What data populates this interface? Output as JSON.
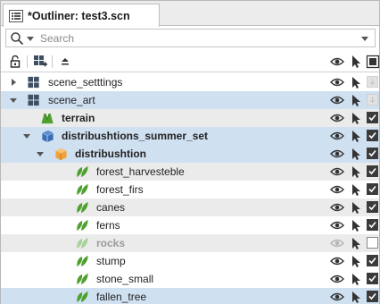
{
  "tab": {
    "title": "*Outliner: test3.scn",
    "icon": "outliner-list-icon"
  },
  "search": {
    "placeholder": "Search",
    "value": ""
  },
  "toolbar": {
    "icons": [
      "lock-icon",
      "add-group-icon",
      "collapse-up-icon",
      "eye-icon",
      "select-arrow-icon",
      "checkbox-column-icon"
    ]
  },
  "colors": {
    "selected_row": "#cfe0f1",
    "alt_row": "#ebebeb",
    "leaf_green": "#4ea12e",
    "leaf_green_dim": "#a8d39a",
    "box_blue": "#3a6db5",
    "box_orange": "#f0a23c"
  },
  "rows": [
    {
      "label": "scene_setttings",
      "icon": "scene-blocks-icon",
      "expander": "collapsed",
      "bold": false,
      "visible": true,
      "checkbox": "disabled"
    },
    {
      "label": "scene_art",
      "icon": "scene-blocks-icon",
      "expander": "expanded",
      "bold": false,
      "visible": true,
      "checkbox": "disabled"
    },
    {
      "label": "terrain",
      "icon": "terrain-icon",
      "expander": "none",
      "bold": true,
      "visible": true,
      "checkbox": "checked"
    },
    {
      "label": "distribushtions_summer_set",
      "icon": "blue-box-icon",
      "expander": "expanded",
      "bold": true,
      "visible": true,
      "checkbox": "checked"
    },
    {
      "label": "distribushtion",
      "icon": "orange-box-icon",
      "expander": "expanded",
      "bold": true,
      "visible": true,
      "checkbox": "checked"
    },
    {
      "label": "forest_harvesteble",
      "icon": "leaf-icon",
      "expander": "none",
      "bold": false,
      "visible": true,
      "checkbox": "checked"
    },
    {
      "label": "forest_firs",
      "icon": "leaf-icon",
      "expander": "none",
      "bold": false,
      "visible": true,
      "checkbox": "checked"
    },
    {
      "label": "canes",
      "icon": "leaf-icon",
      "expander": "none",
      "bold": false,
      "visible": true,
      "checkbox": "checked"
    },
    {
      "label": "ferns",
      "icon": "leaf-icon",
      "expander": "none",
      "bold": false,
      "visible": true,
      "checkbox": "checked"
    },
    {
      "label": "rocks",
      "icon": "leaf-icon",
      "expander": "none",
      "bold": true,
      "visible": false,
      "checkbox": "unchecked"
    },
    {
      "label": "stump",
      "icon": "leaf-icon",
      "expander": "none",
      "bold": false,
      "visible": true,
      "checkbox": "checked"
    },
    {
      "label": "stone_small",
      "icon": "leaf-icon",
      "expander": "none",
      "bold": false,
      "visible": true,
      "checkbox": "checked"
    },
    {
      "label": "fallen_tree",
      "icon": "leaf-icon",
      "expander": "none",
      "bold": false,
      "visible": true,
      "checkbox": "checked"
    }
  ]
}
